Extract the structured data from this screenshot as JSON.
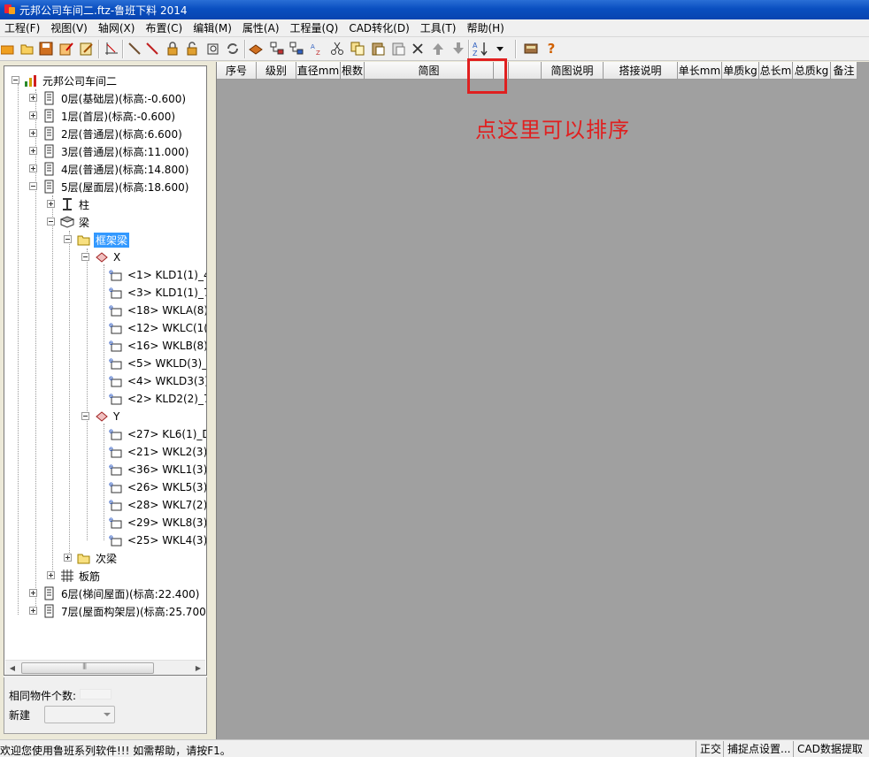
{
  "window": {
    "title": "元邦公司车间二.ftz-鲁班下料 2014"
  },
  "menu": [
    "工程(F)",
    "视图(V)",
    "轴网(X)",
    "布置(C)",
    "编辑(M)",
    "属性(A)",
    "工程量(Q)",
    "CAD转化(D)",
    "工具(T)",
    "帮助(H)"
  ],
  "toolbar": {
    "icons": [
      "open-folder-icon",
      "open-file-icon",
      "save-icon",
      "edit-icon",
      "edit-pencil-icon",
      "axis-icon",
      "line-icon",
      "line-red-icon",
      "lock-icon",
      "unlock-icon",
      "view-icon",
      "refresh-icon",
      "book-icon",
      "hierarchy-icon",
      "hierarchy2-icon",
      "sort-az-small-icon",
      "cut-icon",
      "copy-icon",
      "paste-icon",
      "paste-special-icon",
      "delete-icon",
      "move-up-icon",
      "move-down-icon",
      "sort-az-icon",
      "dropdown-icon",
      "calculator-icon",
      "help-icon"
    ],
    "help_glyph": "?"
  },
  "tree": {
    "root": "元邦公司车间二",
    "floors": [
      "0层(基础层)(标高:-0.600)",
      "1层(首层)(标高:-0.600)",
      "2层(普通层)(标高:6.600)",
      "3层(普通层)(标高:11.000)",
      "4层(普通层)(标高:14.800)",
      "5层(屋面层)(标高:18.600)"
    ],
    "column": "柱",
    "beam": "梁",
    "frame_beam": "框架梁",
    "x_group": "X",
    "x_items": [
      "<1> KLD1(1)_4",
      "<3> KLD1(1)_7",
      "<18> WKLA(8)",
      "<12> WKLC(1(",
      "<16> WKLB(8)",
      "<5> WKLD(3)_",
      "<4> WKLD3(3)",
      "<2> KLD2(2)_7"
    ],
    "y_group": "Y",
    "y_items": [
      "<27> KL6(1)_D",
      "<21> WKL2(3)",
      "<36> WKL1(3)",
      "<26> WKL5(3)",
      "<28> WKL7(2)",
      "<29> WKL8(3)",
      "<25> WKL4(3)"
    ],
    "secondary_beam": "次梁",
    "slab_rebar": "板筋",
    "floors_after": [
      "6层(梯间屋面)(标高:22.400)",
      "7层(屋面构架层)(标高:25.700)"
    ]
  },
  "left_bottom": {
    "same_count_label": "相同物件个数:",
    "new_label": "新建"
  },
  "grid": {
    "columns": [
      "序号",
      "级别",
      "直径mm",
      "根数",
      "简图",
      "",
      "简图说明",
      "搭接说明",
      "单长mm",
      "单质kg",
      "总长m",
      "总质kg",
      "备注"
    ]
  },
  "annotation": {
    "text": "点这里可以排序",
    "color": "#e02020"
  },
  "status": {
    "message": "欢迎您使用鲁班系列软件!!!  如需帮助，请按F1。",
    "pane1": "正交",
    "pane2": "捕捉点设置...",
    "pane3": "CAD数据提取"
  }
}
